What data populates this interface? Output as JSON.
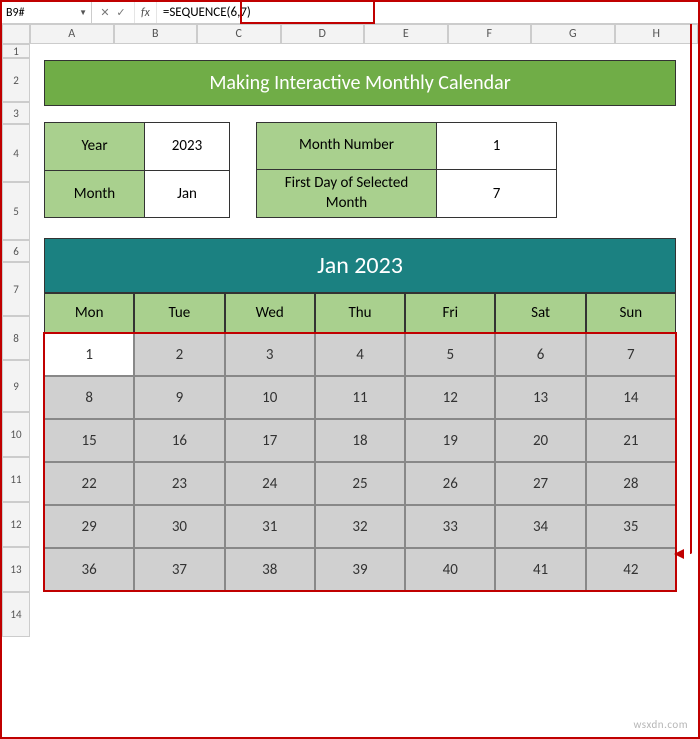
{
  "name_box": "B9#",
  "formula": "=SEQUENCE(6,7)",
  "columns": [
    "A",
    "B",
    "C",
    "D",
    "E",
    "F",
    "G",
    "H"
  ],
  "rows": [
    "1",
    "2",
    "3",
    "4",
    "5",
    "6",
    "7",
    "8",
    "9",
    "10",
    "11",
    "12",
    "13",
    "14"
  ],
  "banner": "Making Interactive Monthly Calendar",
  "inputs": {
    "year_label": "Year",
    "year": "2023",
    "month_label": "Month",
    "month": "Jan",
    "monthnum_label": "Month Number",
    "monthnum": "1",
    "firstday_label": "First Day of Selected Month",
    "firstday": "7"
  },
  "calendar": {
    "title": "Jan 2023",
    "days": [
      "Mon",
      "Tue",
      "Wed",
      "Thu",
      "Fri",
      "Sat",
      "Sun"
    ],
    "grid": [
      [
        1,
        2,
        3,
        4,
        5,
        6,
        7
      ],
      [
        8,
        9,
        10,
        11,
        12,
        13,
        14
      ],
      [
        15,
        16,
        17,
        18,
        19,
        20,
        21
      ],
      [
        22,
        23,
        24,
        25,
        26,
        27,
        28
      ],
      [
        29,
        30,
        31,
        32,
        33,
        34,
        35
      ],
      [
        36,
        37,
        38,
        39,
        40,
        41,
        42
      ]
    ]
  },
  "watermark": "wsxdn.com"
}
